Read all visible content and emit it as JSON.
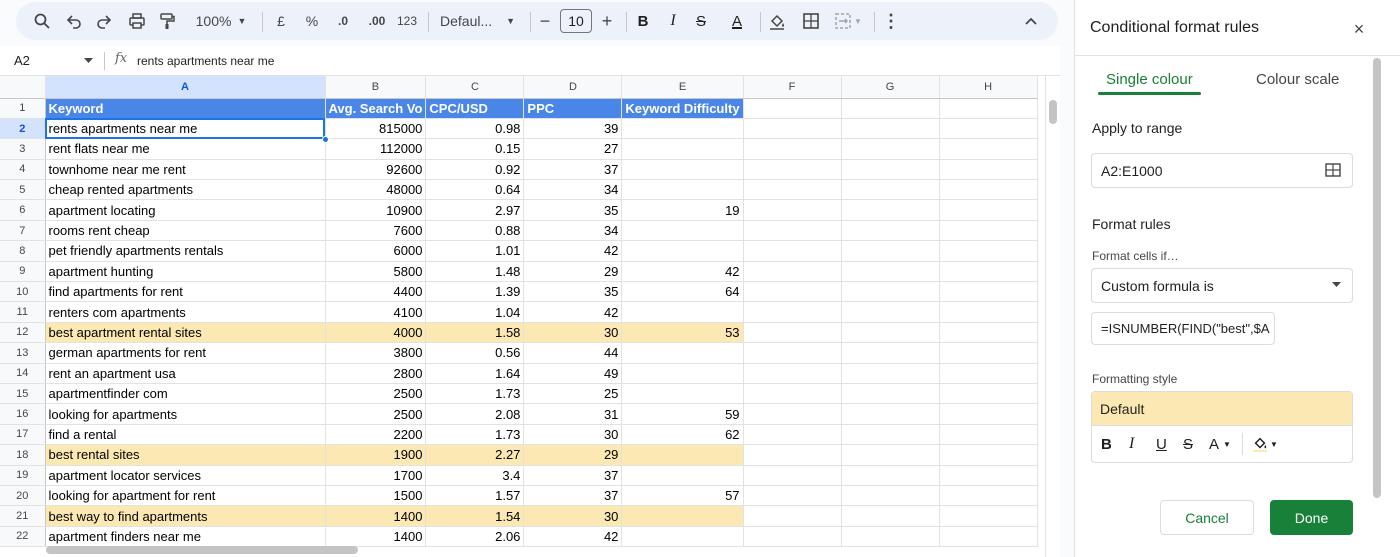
{
  "toolbar": {
    "zoom": "100%",
    "currency": "£",
    "percent": "%",
    "decrease_decimal": ".0",
    "increase_decimal": ".00",
    "number_format": "123",
    "font": "Defaul...",
    "font_size": "10",
    "minus": "−",
    "plus": "+",
    "bold": "B",
    "italic": "I",
    "strikethrough": "S",
    "text_color": "A"
  },
  "formula_bar": {
    "cell_ref": "A2",
    "fx": "fx",
    "content": "rents apartments near me"
  },
  "sheet": {
    "columns": [
      "A",
      "B",
      "C",
      "D",
      "E",
      "F",
      "G",
      "H"
    ],
    "header_row": [
      "Keyword",
      "Avg. Search Vo",
      "CPC/USD",
      "PPC",
      "Keyword Difficulty"
    ],
    "rows": [
      {
        "n": "2",
        "keyword": "rents apartments near me",
        "search": "815000",
        "cpc": "0.98",
        "ppc": "39",
        "kd": ""
      },
      {
        "n": "3",
        "keyword": "rent flats near me",
        "search": "112000",
        "cpc": "0.15",
        "ppc": "27",
        "kd": ""
      },
      {
        "n": "4",
        "keyword": "townhome near me rent",
        "search": "92600",
        "cpc": "0.92",
        "ppc": "37",
        "kd": ""
      },
      {
        "n": "5",
        "keyword": "cheap rented apartments",
        "search": "48000",
        "cpc": "0.64",
        "ppc": "34",
        "kd": ""
      },
      {
        "n": "6",
        "keyword": "apartment locating",
        "search": "10900",
        "cpc": "2.97",
        "ppc": "35",
        "kd": "19"
      },
      {
        "n": "7",
        "keyword": "rooms rent cheap",
        "search": "7600",
        "cpc": "0.88",
        "ppc": "34",
        "kd": ""
      },
      {
        "n": "8",
        "keyword": "pet friendly apartments rentals",
        "search": "6000",
        "cpc": "1.01",
        "ppc": "42",
        "kd": ""
      },
      {
        "n": "9",
        "keyword": "apartment hunting",
        "search": "5800",
        "cpc": "1.48",
        "ppc": "29",
        "kd": "42"
      },
      {
        "n": "10",
        "keyword": "find apartments for rent",
        "search": "4400",
        "cpc": "1.39",
        "ppc": "35",
        "kd": "64"
      },
      {
        "n": "11",
        "keyword": "renters com apartments",
        "search": "4100",
        "cpc": "1.04",
        "ppc": "42",
        "kd": ""
      },
      {
        "n": "12",
        "keyword": "best apartment rental sites",
        "search": "4000",
        "cpc": "1.58",
        "ppc": "30",
        "kd": "53",
        "highlight": true
      },
      {
        "n": "13",
        "keyword": "german apartments for rent",
        "search": "3800",
        "cpc": "0.56",
        "ppc": "44",
        "kd": ""
      },
      {
        "n": "14",
        "keyword": "rent an apartment usa",
        "search": "2800",
        "cpc": "1.64",
        "ppc": "49",
        "kd": ""
      },
      {
        "n": "15",
        "keyword": "apartmentfinder com",
        "search": "2500",
        "cpc": "1.73",
        "ppc": "25",
        "kd": ""
      },
      {
        "n": "16",
        "keyword": "looking for apartments",
        "search": "2500",
        "cpc": "2.08",
        "ppc": "31",
        "kd": "59"
      },
      {
        "n": "17",
        "keyword": "find a rental",
        "search": "2200",
        "cpc": "1.73",
        "ppc": "30",
        "kd": "62"
      },
      {
        "n": "18",
        "keyword": "best rental sites",
        "search": "1900",
        "cpc": "2.27",
        "ppc": "29",
        "kd": "",
        "highlight": true
      },
      {
        "n": "19",
        "keyword": "apartment locator services",
        "search": "1700",
        "cpc": "3.4",
        "ppc": "37",
        "kd": ""
      },
      {
        "n": "20",
        "keyword": "looking for apartment for rent",
        "search": "1500",
        "cpc": "1.57",
        "ppc": "37",
        "kd": "57"
      },
      {
        "n": "21",
        "keyword": "best way to find apartments",
        "search": "1400",
        "cpc": "1.54",
        "ppc": "30",
        "kd": "",
        "highlight": true
      },
      {
        "n": "22",
        "keyword": "apartment finders near me",
        "search": "1400",
        "cpc": "2.06",
        "ppc": "42",
        "kd": ""
      }
    ]
  },
  "panel": {
    "title": "Conditional format rules",
    "close": "×",
    "tabs": [
      "Single colour",
      "Colour scale"
    ],
    "apply_label": "Apply to range",
    "range": "A2:E1000",
    "rules_label": "Format rules",
    "format_cells_if": "Format cells if…",
    "condition": "Custom formula is",
    "formula": "=ISNUMBER(FIND(\"best\",$A",
    "style_label": "Formatting style",
    "style_preview": "Default",
    "style_buttons": {
      "bold": "B",
      "italic": "I",
      "underline": "U",
      "strike": "S",
      "text_color": "A"
    },
    "cancel": "Cancel",
    "done": "Done"
  },
  "colors": {
    "header_fill": "#4a86e8",
    "highlight_fill": "#fce8b2",
    "accent_green": "#188038",
    "selection_blue": "#1a73e8"
  }
}
